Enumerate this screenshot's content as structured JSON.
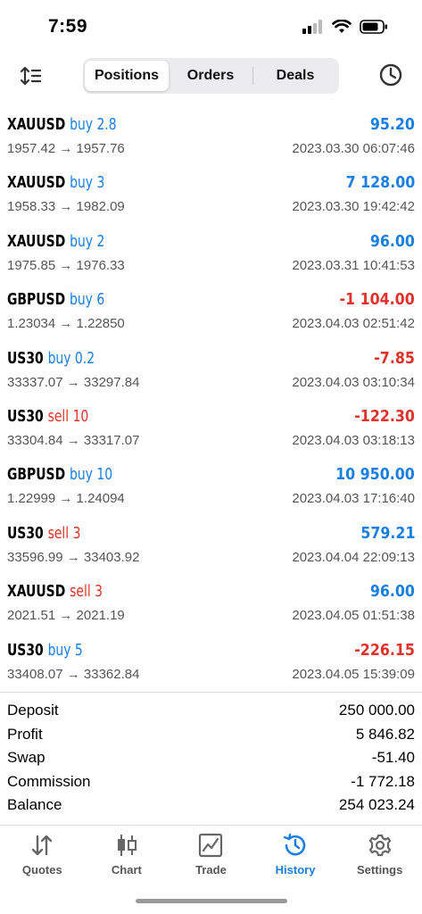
{
  "status": {
    "time": "7:59"
  },
  "toolbar": {
    "tabs": [
      {
        "label": "Positions",
        "active": true
      },
      {
        "label": "Orders",
        "active": false
      },
      {
        "label": "Deals",
        "active": false
      }
    ],
    "icons": {
      "left": "sort-icon",
      "right": "history-clock-icon"
    }
  },
  "positions": [
    {
      "symbol": "XAUUSD",
      "side": "buy",
      "volume": "buy 2.8",
      "prices": "1957.42 → 1957.76",
      "profit": "95.20",
      "time": "2023.03.30 06:07:46"
    },
    {
      "symbol": "XAUUSD",
      "side": "buy",
      "volume": "buy 3",
      "prices": "1958.33 → 1982.09",
      "profit": "7 128.00",
      "time": "2023.03.30 19:42:42"
    },
    {
      "symbol": "XAUUSD",
      "side": "buy",
      "volume": "buy 2",
      "prices": "1975.85 → 1976.33",
      "profit": "96.00",
      "time": "2023.03.31 10:41:53"
    },
    {
      "symbol": "GBPUSD",
      "side": "buy",
      "volume": "buy 6",
      "prices": "1.23034 → 1.22850",
      "profit": "-1 104.00",
      "time": "2023.04.03 02:51:42"
    },
    {
      "symbol": "US30",
      "side": "buy",
      "volume": "buy 0.2",
      "prices": "33337.07 → 33297.84",
      "profit": "-7.85",
      "time": "2023.04.03 03:10:34"
    },
    {
      "symbol": "US30",
      "side": "sell",
      "volume": "sell 10",
      "prices": "33304.84 → 33317.07",
      "profit": "-122.30",
      "time": "2023.04.03 03:18:13"
    },
    {
      "symbol": "GBPUSD",
      "side": "buy",
      "volume": "buy 10",
      "prices": "1.22999 → 1.24094",
      "profit": "10 950.00",
      "time": "2023.04.03 17:16:40"
    },
    {
      "symbol": "US30",
      "side": "sell",
      "volume": "sell 3",
      "prices": "33596.99 → 33403.92",
      "profit": "579.21",
      "time": "2023.04.04 22:09:13"
    },
    {
      "symbol": "XAUUSD",
      "side": "sell",
      "volume": "sell 3",
      "prices": "2021.51 → 2021.19",
      "profit": "96.00",
      "time": "2023.04.05 01:51:38"
    },
    {
      "symbol": "US30",
      "side": "buy",
      "volume": "buy 5",
      "prices": "33408.07 → 33362.84",
      "profit": "-226.15",
      "time": "2023.04.05 15:39:09"
    }
  ],
  "summary": [
    {
      "label": "Deposit",
      "value": "250 000.00"
    },
    {
      "label": "Profit",
      "value": "5 846.82"
    },
    {
      "label": "Swap",
      "value": "-51.40"
    },
    {
      "label": "Commission",
      "value": "-1 772.18"
    },
    {
      "label": "Balance",
      "value": "254 023.24"
    }
  ],
  "tabbar": [
    {
      "label": "Quotes",
      "icon": "quotes-arrows-icon",
      "active": false
    },
    {
      "label": "Chart",
      "icon": "candlestick-icon",
      "active": false
    },
    {
      "label": "Trade",
      "icon": "trade-chart-icon",
      "active": false
    },
    {
      "label": "History",
      "icon": "history-clock-icon",
      "active": true
    },
    {
      "label": "Settings",
      "icon": "gear-icon",
      "active": false
    }
  ],
  "colors": {
    "buy": "#1a7fe0",
    "sell": "#e0322a",
    "accent": "#1a7fe0"
  }
}
